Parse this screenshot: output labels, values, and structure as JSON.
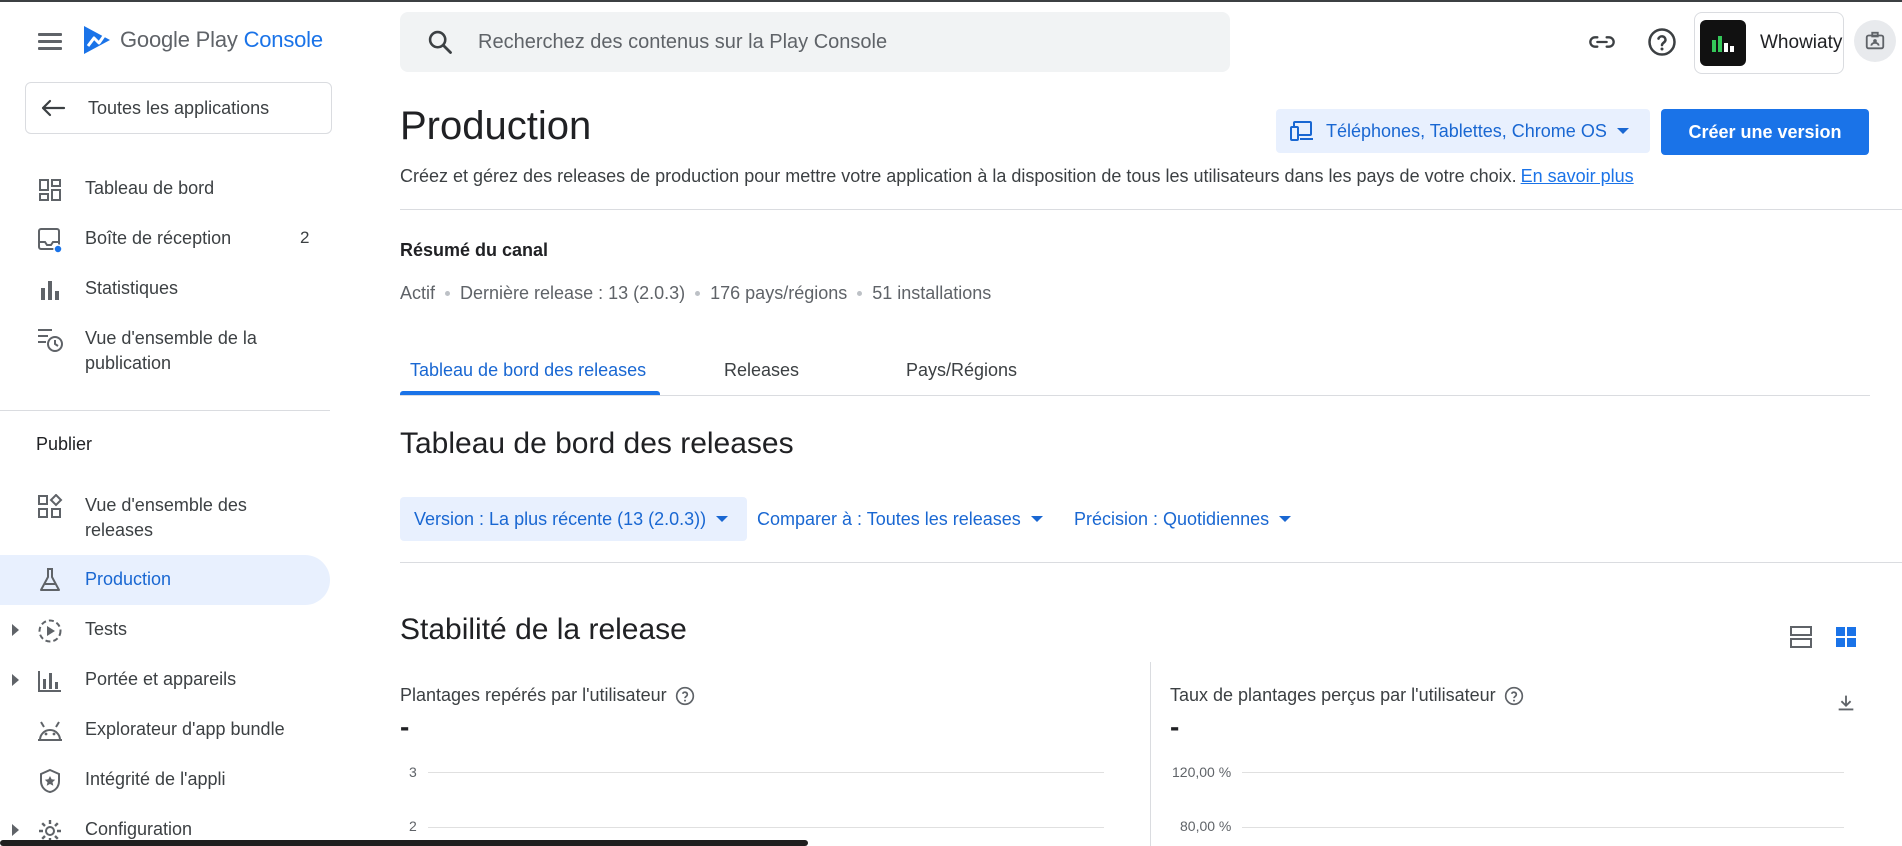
{
  "header": {
    "logo_text_main": "Google Play",
    "logo_text_accent": "Console",
    "search_placeholder": "Recherchez des contenus sur la Play Console",
    "account_name": "Whowiaty"
  },
  "sidebar": {
    "back_label": "Toutes les applications",
    "items": [
      {
        "label": "Tableau de bord",
        "icon": "dashboard-icon"
      },
      {
        "label": "Boîte de réception",
        "icon": "inbox-icon",
        "count": "2"
      },
      {
        "label": "Statistiques",
        "icon": "bar-chart-icon"
      },
      {
        "label": "Vue d'ensemble de la publication",
        "icon": "publishing-overview-icon"
      }
    ],
    "section_title": "Publier",
    "publish_items": [
      {
        "label": "Vue d'ensemble des releases",
        "icon": "releases-overview-icon"
      },
      {
        "label": "Production",
        "icon": "production-icon",
        "active": true
      },
      {
        "label": "Tests",
        "icon": "tests-icon",
        "expandable": true
      },
      {
        "label": "Portée et appareils",
        "icon": "reach-devices-icon",
        "expandable": true
      },
      {
        "label": "Explorateur d'app bundle",
        "icon": "app-bundle-icon"
      },
      {
        "label": "Intégrité de l'appli",
        "icon": "integrity-shield-icon"
      },
      {
        "label": "Configuration",
        "icon": "gear-icon",
        "expandable": true
      }
    ]
  },
  "main": {
    "title": "Production",
    "form_factor": "Téléphones, Tablettes, Chrome OS",
    "create_button": "Créer une version",
    "description": "Créez et gérez des releases de production pour mettre votre application à la disposition de tous les utilisateurs dans les pays de votre choix.",
    "learn_more": "En savoir plus",
    "summary": {
      "title": "Résumé du canal",
      "status": "Actif",
      "last_release": "Dernière release : 13 (2.0.3)",
      "countries": "176 pays/régions",
      "installs": "51 installations"
    },
    "tabs": [
      "Tableau de bord des releases",
      "Releases",
      "Pays/Régions"
    ],
    "dashboard_title": "Tableau de bord des releases",
    "filters": {
      "version": "Version : La plus récente (13 (2.0.3))",
      "compare": "Comparer à : Toutes les releases",
      "precision": "Précision : Quotidiennes"
    },
    "stability_title": "Stabilité de la release",
    "charts": [
      {
        "title": "Plantages repérés par l'utilisateur",
        "value": "-",
        "ticks": [
          "3",
          "2"
        ]
      },
      {
        "title": "Taux de plantages perçus par l'utilisateur",
        "value": "-",
        "ticks": [
          "120,00 %",
          "80,00 %"
        ]
      }
    ]
  },
  "colors": {
    "accent": "#1a73e8",
    "accent_bg": "#e8f0fe",
    "text": "#202124",
    "secondary_text": "#5f6368"
  }
}
